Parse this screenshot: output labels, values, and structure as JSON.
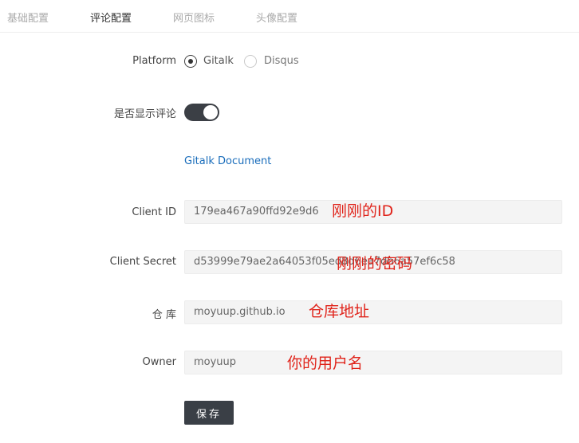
{
  "tabs": [
    {
      "label": "基础配置",
      "active": false
    },
    {
      "label": "评论配置",
      "active": true
    },
    {
      "label": "网页图标",
      "active": false
    },
    {
      "label": "头像配置",
      "active": false
    }
  ],
  "form": {
    "platform": {
      "label": "Platform",
      "options": [
        {
          "label": "Gitalk",
          "selected": true
        },
        {
          "label": "Disqus",
          "selected": false
        }
      ]
    },
    "show_comments": {
      "label": "是否显示评论",
      "enabled": true
    },
    "doc_link": "Gitalk Document",
    "client_id": {
      "label": "Client ID",
      "value": "179ea467a90ffd92e9d6"
    },
    "client_secret": {
      "label": "Client Secret",
      "value": "d53999e79ae2a64053f05ed8d6ea7db6a57ef6c58"
    },
    "repo": {
      "label": "仓 库",
      "value": "moyuup.github.io"
    },
    "owner": {
      "label": "Owner",
      "value": "moyuup"
    },
    "save_label": "保存"
  },
  "annotations": {
    "client_id_note": "刚刚的ID",
    "client_secret_note": "刚刚的密码",
    "repo_note": "仓库地址",
    "owner_note": "你的用户名"
  },
  "colors": {
    "accent_dark": "#3a3f46",
    "link": "#1a6dbb",
    "annotation_red": "#e0231a"
  }
}
